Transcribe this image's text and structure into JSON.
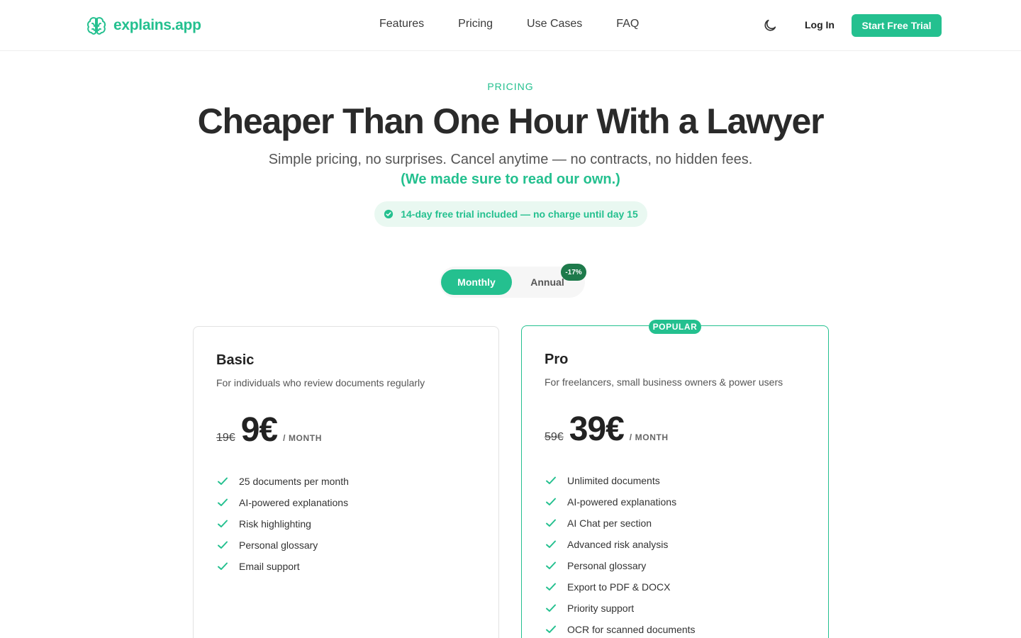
{
  "header": {
    "logo_text": "explains.app",
    "nav": [
      "Features",
      "Pricing",
      "Use Cases",
      "FAQ"
    ],
    "theme_icon": "moon-icon",
    "login_label": "Log In",
    "cta_label": "Start Free Trial"
  },
  "hero": {
    "eyebrow": "PRICING",
    "title": "Cheaper Than One Hour With a Lawyer",
    "subtitle": "Simple pricing, no surprises. Cancel anytime — no contracts, no hidden fees.",
    "subtitle_highlight": "(We made sure to read our own.)",
    "trial_note": "14-day free trial included — no charge until day 15"
  },
  "billing_toggle": {
    "monthly_label": "Monthly",
    "annual_label": "Annual",
    "discount_badge": "-17%",
    "selected": "Monthly"
  },
  "plans": [
    {
      "name": "Basic",
      "description": "For individuals who review documents regularly",
      "old_price": "19€",
      "price": "9€",
      "period": "/ MONTH",
      "features": [
        "25 documents per month",
        "AI-powered explanations",
        "Risk highlighting",
        "Personal glossary",
        "Email support"
      ]
    },
    {
      "name": "Pro",
      "badge": "POPULAR",
      "description": "For freelancers, small business owners & power users",
      "old_price": "59€",
      "price": "39€",
      "period": "/ MONTH",
      "features": [
        "Unlimited documents",
        "AI-powered explanations",
        "AI Chat per section",
        "Advanced risk analysis",
        "Personal glossary",
        "Export to PDF & DOCX",
        "Priority support",
        "OCR for scanned documents"
      ]
    }
  ],
  "colors": {
    "accent": "#24c08f",
    "badge_dark": "#1e7a4b",
    "pill_bg": "#e9f8f1"
  }
}
